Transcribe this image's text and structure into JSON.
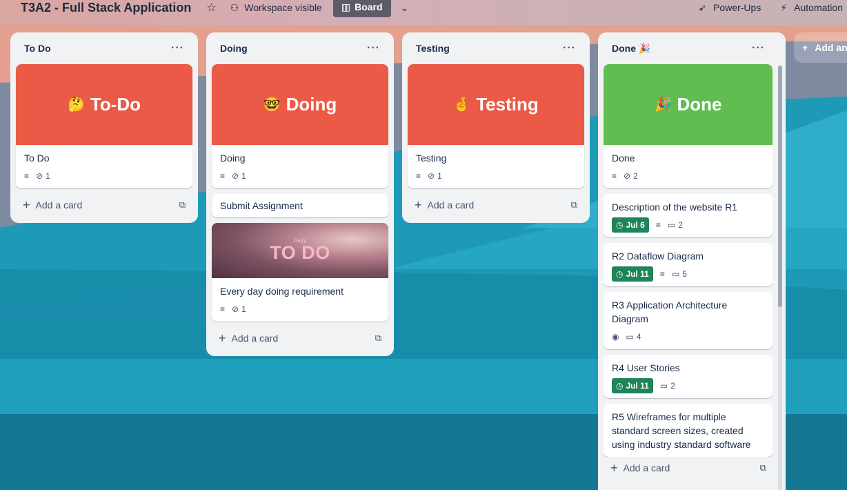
{
  "board": {
    "title": "T3A2 - Full Stack Application",
    "visibility": "Workspace visible",
    "view": "Board"
  },
  "toolbar": {
    "powerups": "Power-Ups",
    "automation": "Automation"
  },
  "add_list_label": "Add another list",
  "add_card_label": "Add a card",
  "lists": [
    {
      "title": "To Do",
      "cards": [
        {
          "cover_text": "To-Do",
          "cover_emoji": "🤔",
          "cover_color": "#eb5a46",
          "title": "To Do",
          "attachments": "1"
        }
      ]
    },
    {
      "title": "Doing",
      "cards": [
        {
          "cover_text": "Doing",
          "cover_emoji": "🤓",
          "cover_color": "#eb5a46",
          "title": "Doing",
          "attachments": "1"
        },
        {
          "title": "Submit Assignment"
        },
        {
          "cover_small": "Daily",
          "cover_big": "TO DO",
          "title": "Every day doing requirement",
          "attachments": "1"
        }
      ]
    },
    {
      "title": "Testing",
      "cards": [
        {
          "cover_text": "Testing",
          "cover_emoji": "🤞",
          "cover_color": "#eb5a46",
          "title": "Testing",
          "attachments": "1"
        }
      ]
    },
    {
      "title": "Done 🎉",
      "cards": [
        {
          "cover_text": "Done",
          "cover_emoji": "🎉",
          "cover_color": "#61bd4f",
          "title": "Done",
          "attachments": "2"
        },
        {
          "title": "Description of the website R1",
          "due": "Jul 6",
          "comments": "2"
        },
        {
          "title": "R2 Dataflow Diagram",
          "due": "Jul 11",
          "comments": "5"
        },
        {
          "title": "R3 Application Architecture Diagram",
          "comments": "4"
        },
        {
          "title": "R4 User Stories",
          "due": "Jul 11",
          "comments": "2"
        },
        {
          "title": "R5 Wireframes for multiple standard screen sizes, created using industry standard software"
        }
      ]
    }
  ],
  "colors": {
    "due_green": "#1f845a",
    "list_bg": "#f1f2f4",
    "board_button": "#5b5c68"
  },
  "icons": [
    "star-icon",
    "workspace-icon",
    "board-icon",
    "chevron-down-icon",
    "rocket-icon",
    "lightning-icon",
    "list-menu-icon",
    "description-icon",
    "attachment-icon",
    "comment-icon",
    "clock-icon",
    "eye-icon",
    "plus-icon",
    "template-icon"
  ]
}
